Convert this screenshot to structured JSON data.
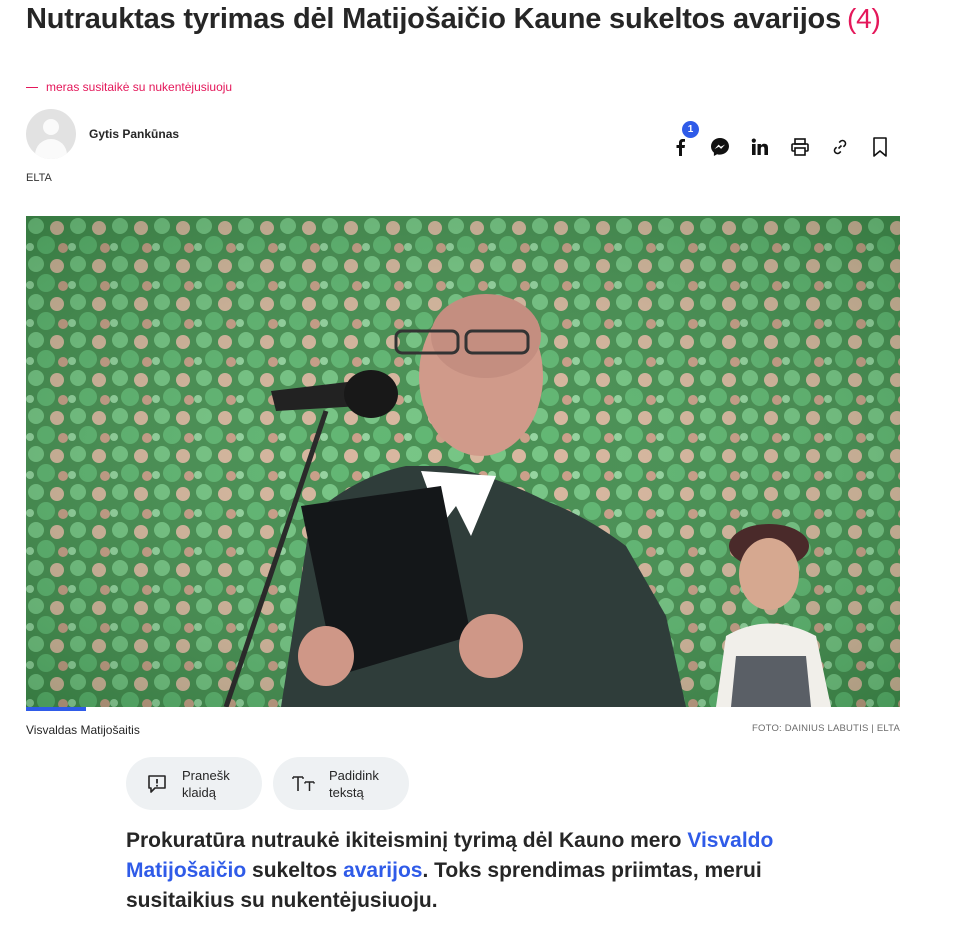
{
  "article": {
    "headline": "Nutrauktas tyrimas dėl Matijošaičio Kaune sukeltos avarijos",
    "comments_count": "(4)",
    "subtitle": "meras susitaikė su nukentėjusiuoju",
    "author": "Gytis Pankūnas",
    "source": "ELTA"
  },
  "share": {
    "facebook_count": "1",
    "icons": [
      "facebook-icon",
      "messenger-icon",
      "linkedin-icon",
      "print-icon",
      "link-icon",
      "bookmark-icon"
    ]
  },
  "photo": {
    "caption": "Visvaldas Matijošaitis",
    "credit": "FOTO: DAINIUS LABUTIS | ELTA"
  },
  "actions": {
    "report_error": "Pranešk klaidą",
    "increase_text": "Padidink tekstą"
  },
  "lead": {
    "part1": "Prokuratūra nutraukė ikiteisminį tyrimą dėl Kauno mero ",
    "link1": "Visvaldo Matijošaičio",
    "part2": " sukeltos ",
    "link2": "avarijos",
    "part3": ". Toks sprendimas priimtas, merui susitaikius su nukentėjusiuoju."
  },
  "colors": {
    "accent": "#e4175a",
    "link": "#2f5be8",
    "pill_bg": "#eef1f3"
  }
}
